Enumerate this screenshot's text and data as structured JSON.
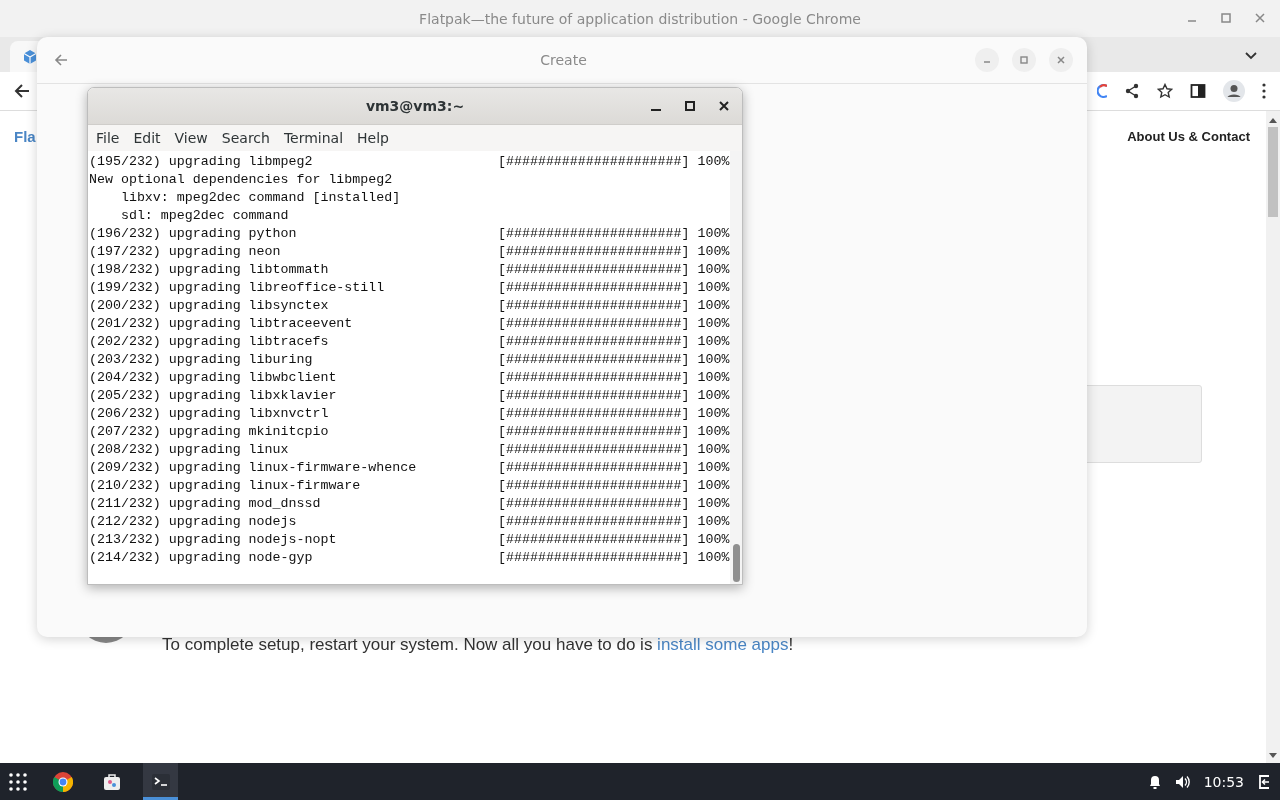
{
  "browser": {
    "title": "Flatpak—the future of application distribution - Google Chrome",
    "page": {
      "logo_text": "Fla",
      "nav_link": "About Us & Contact",
      "setup_before": "To complete setup, restart your system. Now all you have to do is ",
      "setup_link": "install some apps",
      "setup_after": "!"
    }
  },
  "dialog": {
    "title": "Create"
  },
  "terminal": {
    "title": "vm3@vm3:~",
    "menu": [
      "File",
      "Edit",
      "View",
      "Search",
      "Terminal",
      "Help"
    ],
    "lines": [
      {
        "text": "(195/232) upgrading libmpeg2",
        "progress": "[######################] 100%"
      },
      {
        "text": "New optional dependencies for libmpeg2"
      },
      {
        "text": "    libxv: mpeg2dec command [installed]"
      },
      {
        "text": "    sdl: mpeg2dec command"
      },
      {
        "text": "(196/232) upgrading python",
        "progress": "[######################] 100%"
      },
      {
        "text": "(197/232) upgrading neon",
        "progress": "[######################] 100%"
      },
      {
        "text": "(198/232) upgrading libtommath",
        "progress": "[######################] 100%"
      },
      {
        "text": "(199/232) upgrading libreoffice-still",
        "progress": "[######################] 100%"
      },
      {
        "text": "(200/232) upgrading libsynctex",
        "progress": "[######################] 100%"
      },
      {
        "text": "(201/232) upgrading libtraceevent",
        "progress": "[######################] 100%"
      },
      {
        "text": "(202/232) upgrading libtracefs",
        "progress": "[######################] 100%"
      },
      {
        "text": "(203/232) upgrading liburing",
        "progress": "[######################] 100%"
      },
      {
        "text": "(204/232) upgrading libwbclient",
        "progress": "[######################] 100%"
      },
      {
        "text": "(205/232) upgrading libxklavier",
        "progress": "[######################] 100%"
      },
      {
        "text": "(206/232) upgrading libxnvctrl",
        "progress": "[######################] 100%"
      },
      {
        "text": "(207/232) upgrading mkinitcpio",
        "progress": "[######################] 100%"
      },
      {
        "text": "(208/232) upgrading linux",
        "progress": "[######################] 100%"
      },
      {
        "text": "(209/232) upgrading linux-firmware-whence",
        "progress": "[######################] 100%"
      },
      {
        "text": "(210/232) upgrading linux-firmware",
        "progress": "[######################] 100%"
      },
      {
        "text": "(211/232) upgrading mod_dnssd",
        "progress": "[######################] 100%"
      },
      {
        "text": "(212/232) upgrading nodejs",
        "progress": "[######################] 100%"
      },
      {
        "text": "(213/232) upgrading nodejs-nopt",
        "progress": "[######################] 100%"
      },
      {
        "text": "(214/232) upgrading node-gyp",
        "progress": "[######################] 100%"
      }
    ]
  },
  "taskbar": {
    "apps": [
      {
        "kind": "chrome",
        "selected": false
      },
      {
        "kind": "store",
        "selected": false
      },
      {
        "kind": "terminal",
        "selected": true
      }
    ],
    "clock": "10:53"
  }
}
